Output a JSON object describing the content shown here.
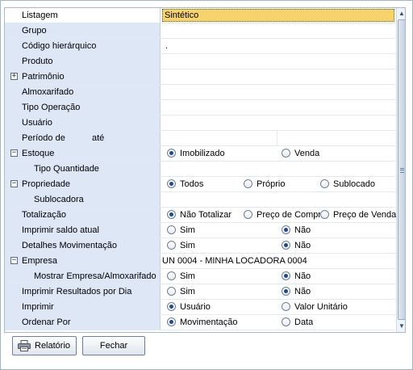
{
  "rows": [
    {
      "label": "Listagem",
      "value": "Sintético"
    },
    {
      "label": "Grupo",
      "value": ""
    },
    {
      "label": "Código hierárquico",
      "value": "."
    },
    {
      "label": "Produto",
      "value": ""
    },
    {
      "label": "Patrimônio",
      "expander": "+",
      "value": ""
    },
    {
      "label": "Almoxarifado",
      "value": ""
    },
    {
      "label": "Tipo Operação",
      "value": ""
    },
    {
      "label": "Usuário",
      "value": ""
    },
    {
      "label": "Período de",
      "label2": "até",
      "value": ""
    },
    {
      "label": "Estoque",
      "expander": "−",
      "options": [
        "Imobilizado",
        "Venda"
      ],
      "selected": 0
    },
    {
      "label": "Tipo Quantidade",
      "value": ""
    },
    {
      "label": "Propriedade",
      "expander": "−",
      "options": [
        "Todos",
        "Próprio",
        "Sublocado"
      ],
      "selected": 0
    },
    {
      "label": "Sublocadora",
      "value": ""
    },
    {
      "label": "Totalização",
      "options": [
        "Não Totalizar",
        "Preço de Compra",
        "Preço de Venda"
      ],
      "selected": 0
    },
    {
      "label": "Imprimir saldo atual",
      "options": [
        "Sim",
        "Não"
      ],
      "selected": 1
    },
    {
      "label": "Detalhes Movimentação",
      "options": [
        "Sim",
        "Não"
      ],
      "selected": 1
    },
    {
      "label": "Empresa",
      "expander": "−",
      "value": "UN 0004 - MINHA LOCADORA 0004"
    },
    {
      "label": "Mostrar Empresa/Almoxarifado",
      "options": [
        "Sim",
        "Não"
      ],
      "selected": 1
    },
    {
      "label": "Imprimir Resultados por Dia",
      "options": [
        "Sim",
        "Não"
      ],
      "selected": 1
    },
    {
      "label": "Imprimir",
      "options": [
        "Usuário",
        "Valor Unitário"
      ],
      "selected": 0
    },
    {
      "label": "Ordenar Por",
      "options": [
        "Movimentação",
        "Data"
      ],
      "selected": 0
    }
  ],
  "buttons": {
    "report_label": "Relatório",
    "close_label": "Fechar"
  },
  "colors": {
    "label_bg": "#dde7f5",
    "selection": "#f7d46b",
    "radio_dot": "#1e4b8f"
  }
}
